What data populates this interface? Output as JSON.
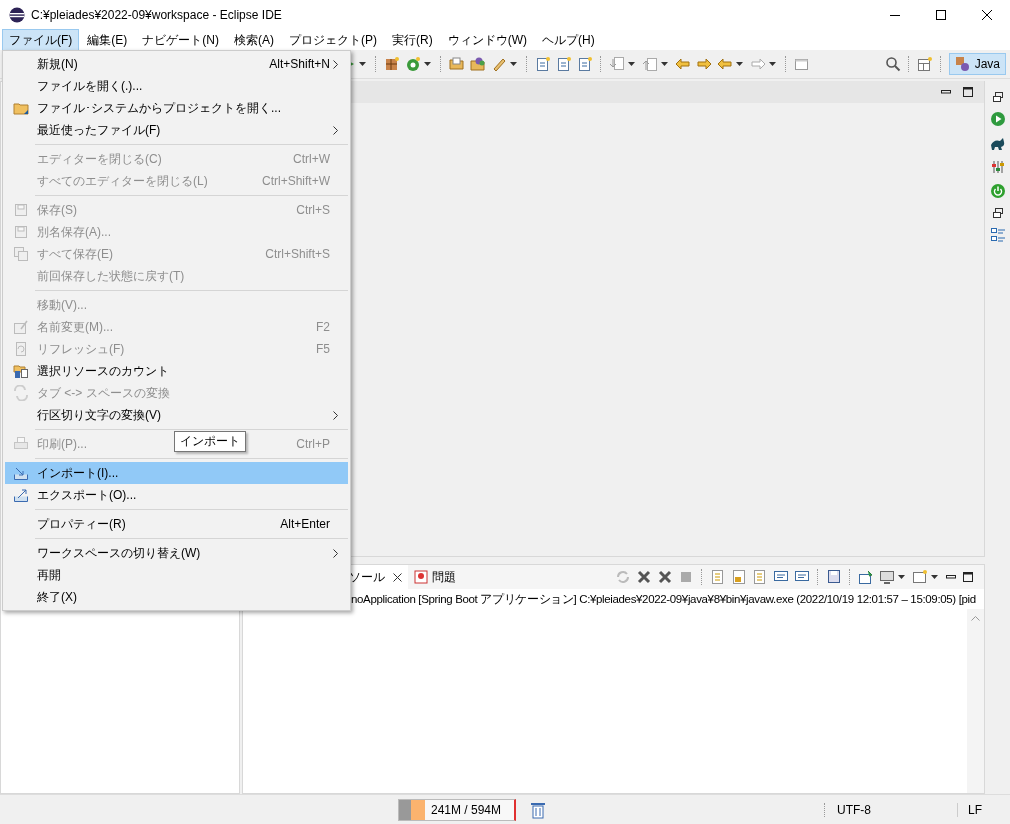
{
  "window": {
    "title": "C:¥pleiades¥2022-09¥workspace - Eclipse IDE"
  },
  "menubar": [
    {
      "label": "ファイル(F)",
      "selected": true
    },
    {
      "label": "編集(E)",
      "selected": false
    },
    {
      "label": "ナビゲート(N)",
      "selected": false
    },
    {
      "label": "検索(A)",
      "selected": false
    },
    {
      "label": "プロジェクト(P)",
      "selected": false
    },
    {
      "label": "実行(R)",
      "selected": false
    },
    {
      "label": "ウィンドウ(W)",
      "selected": false
    },
    {
      "label": "ヘルプ(H)",
      "selected": false
    }
  ],
  "file_menu": {
    "groups": [
      [
        {
          "label": "新規(N)",
          "shortcut": "Alt+Shift+N",
          "submenu": true,
          "disabled": false,
          "selected": false
        },
        {
          "label": "ファイルを開く(.)...",
          "disabled": false,
          "selected": false
        },
        {
          "label": "ファイル･システムからプロジェクトを開く...",
          "disabled": false,
          "selected": false
        },
        {
          "label": "最近使ったファイル(F)",
          "submenu": true,
          "disabled": false,
          "selected": false
        }
      ],
      [
        {
          "label": "エディターを閉じる(C)",
          "shortcut": "Ctrl+W",
          "disabled": true,
          "selected": false
        },
        {
          "label": "すべてのエディターを閉じる(L)",
          "shortcut": "Ctrl+Shift+W",
          "disabled": true,
          "selected": false
        }
      ],
      [
        {
          "label": "保存(S)",
          "shortcut": "Ctrl+S",
          "disabled": true,
          "selected": false
        },
        {
          "label": "別名保存(A)...",
          "disabled": true,
          "selected": false
        },
        {
          "label": "すべて保存(E)",
          "shortcut": "Ctrl+Shift+S",
          "disabled": true,
          "selected": false
        },
        {
          "label": "前回保存した状態に戻す(T)",
          "disabled": true,
          "selected": false
        }
      ],
      [
        {
          "label": "移動(V)...",
          "disabled": true,
          "selected": false
        },
        {
          "label": "名前変更(M)...",
          "shortcut": "F2",
          "disabled": true,
          "selected": false
        },
        {
          "label": "リフレッシュ(F)",
          "shortcut": "F5",
          "disabled": true,
          "selected": false
        },
        {
          "label": "選択リソースのカウント",
          "disabled": false,
          "selected": false
        },
        {
          "label": "タブ <-> スペースの変換",
          "disabled": true,
          "selected": false
        },
        {
          "label": "行区切り文字の変換(V)",
          "submenu": true,
          "disabled": false,
          "selected": false
        }
      ],
      [
        {
          "label": "印刷(P)...",
          "shortcut": "Ctrl+P",
          "disabled": true,
          "selected": false
        }
      ],
      [
        {
          "label": "インポート(I)...",
          "disabled": false,
          "selected": true
        },
        {
          "label": "エクスポート(O)...",
          "disabled": false,
          "selected": false
        }
      ],
      [
        {
          "label": "プロパティー(R)",
          "shortcut": "Alt+Enter",
          "disabled": false,
          "selected": false
        }
      ],
      [
        {
          "label": "ワークスペースの切り替え(W)",
          "submenu": true,
          "disabled": false,
          "selected": false
        },
        {
          "label": "再開",
          "disabled": false,
          "selected": false
        },
        {
          "label": "終了(X)",
          "disabled": false,
          "selected": false
        }
      ]
    ]
  },
  "tooltip": "インポート",
  "perspective": {
    "label": "Java",
    "selected": true
  },
  "console": {
    "tabs": [
      {
        "label": "ソール",
        "selected": true
      },
      {
        "label": "問題",
        "selected": false
      }
    ],
    "line": "noApplication [Spring Boot アプリケーション] C:¥pleiades¥2022-09¥java¥8¥bin¥javaw.exe  (2022/10/19 12:01:57 – 15:09:05) [pid"
  },
  "status_bar": {
    "heap": {
      "text": "241M / 594M",
      "level": 0.23
    },
    "encoding": "UTF-8",
    "line_delimiter": "LF"
  }
}
